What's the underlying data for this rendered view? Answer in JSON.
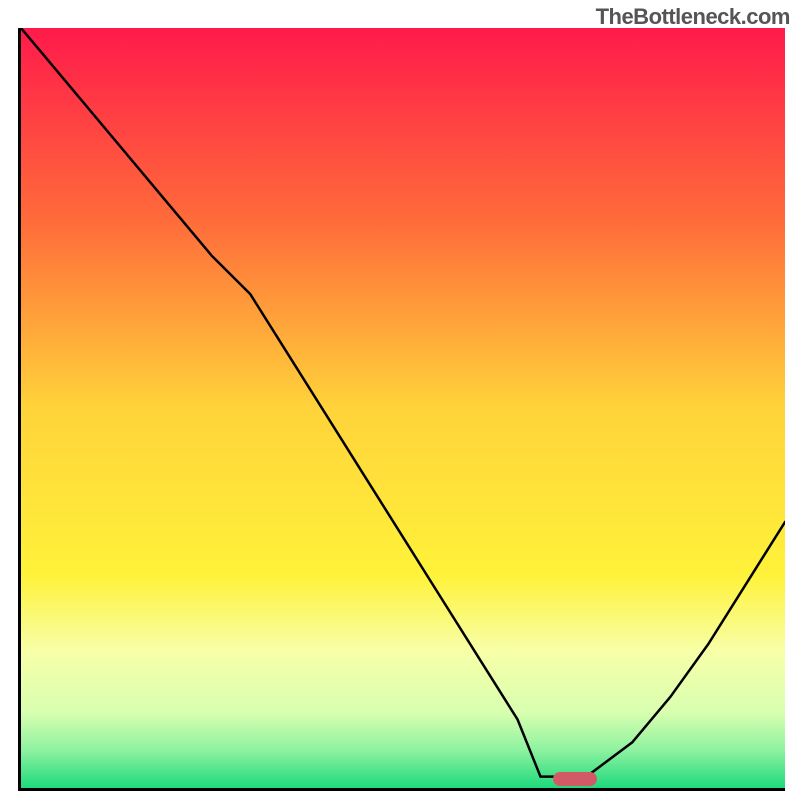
{
  "watermark": "TheBottleneck.com",
  "chart_data": {
    "type": "line",
    "title": "",
    "xlabel": "",
    "ylabel": "",
    "x": [
      0.0,
      0.05,
      0.1,
      0.15,
      0.2,
      0.25,
      0.3,
      0.35,
      0.4,
      0.45,
      0.5,
      0.55,
      0.6,
      0.65,
      0.68,
      0.72,
      0.74,
      0.8,
      0.85,
      0.9,
      0.95,
      1.0
    ],
    "values": [
      1.0,
      0.94,
      0.88,
      0.82,
      0.76,
      0.7,
      0.65,
      0.57,
      0.49,
      0.41,
      0.33,
      0.25,
      0.17,
      0.09,
      0.015,
      0.015,
      0.015,
      0.06,
      0.12,
      0.19,
      0.27,
      0.35
    ],
    "xlim": [
      0,
      1
    ],
    "ylim": [
      0,
      1
    ],
    "marker": {
      "x": 0.725,
      "y": 0.012,
      "color": "#d25a66"
    },
    "gradient_stops": [
      {
        "offset": 0.0,
        "color": "#ff1a4b"
      },
      {
        "offset": 0.25,
        "color": "#ff6a3a"
      },
      {
        "offset": 0.5,
        "color": "#ffd33a"
      },
      {
        "offset": 0.72,
        "color": "#fff23a"
      },
      {
        "offset": 0.82,
        "color": "#f7ffa8"
      },
      {
        "offset": 0.9,
        "color": "#d9ffb0"
      },
      {
        "offset": 0.95,
        "color": "#8ef2a0"
      },
      {
        "offset": 1.0,
        "color": "#1ed97c"
      }
    ]
  }
}
